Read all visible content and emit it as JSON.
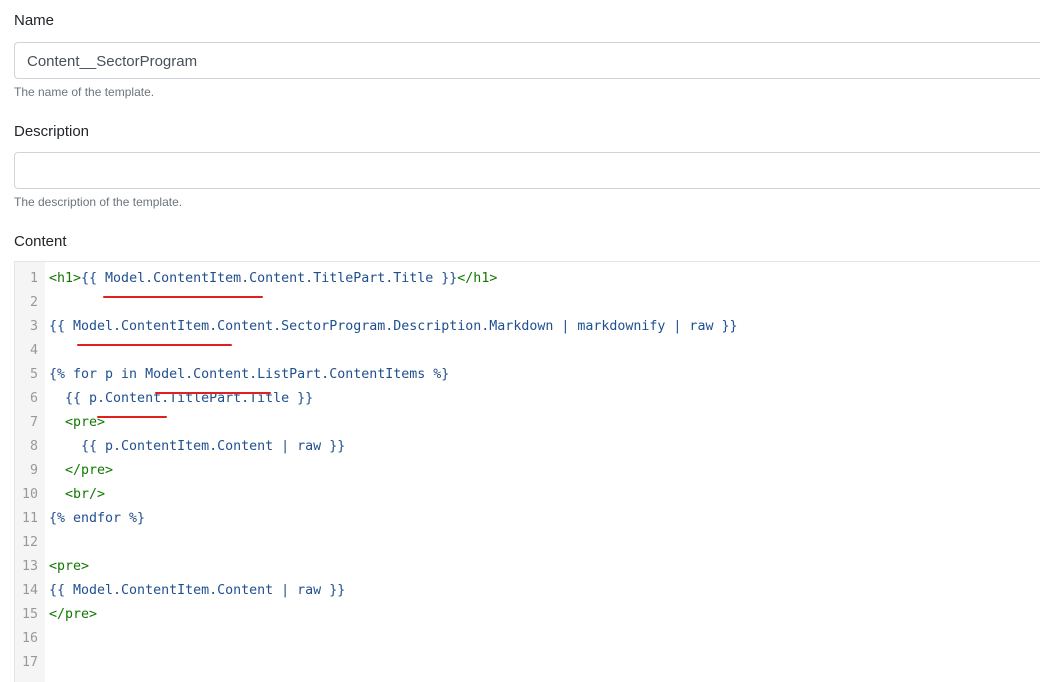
{
  "name_field": {
    "label": "Name",
    "value": "Content__SectorProgram",
    "hint": "The name of the template."
  },
  "description_field": {
    "label": "Description",
    "value": "",
    "hint": "The description of the template."
  },
  "content_field": {
    "label": "Content",
    "lines": [
      {
        "n": "1",
        "tokens": [
          {
            "t": "<h1>",
            "c": "tag"
          },
          {
            "t": "{{ Model.ContentItem.Content.TitlePart.Title }}",
            "c": "liquid"
          },
          {
            "t": "</h1>",
            "c": "tag"
          }
        ]
      },
      {
        "n": "2",
        "tokens": []
      },
      {
        "n": "3",
        "tokens": [
          {
            "t": "{{ Model.ContentItem.Content.SectorProgram.Description.Markdown | markdownify | raw }}",
            "c": "liquid"
          }
        ]
      },
      {
        "n": "4",
        "tokens": []
      },
      {
        "n": "5",
        "tokens": [
          {
            "t": "{% for p in Model.Content.ListPart.ContentItems %}",
            "c": "liquid"
          }
        ]
      },
      {
        "n": "6",
        "tokens": [
          {
            "t": "  {{ p.Content.TitlePart.Title }}",
            "c": "liquid"
          }
        ]
      },
      {
        "n": "7",
        "tokens": [
          {
            "t": "  <pre>",
            "c": "tag"
          }
        ]
      },
      {
        "n": "8",
        "tokens": [
          {
            "t": "    {{ p.ContentItem.Content | raw }}",
            "c": "liquid"
          }
        ]
      },
      {
        "n": "9",
        "tokens": [
          {
            "t": "  </pre>",
            "c": "tag"
          }
        ]
      },
      {
        "n": "10",
        "tokens": [
          {
            "t": "  <br/>",
            "c": "tag"
          }
        ]
      },
      {
        "n": "11",
        "tokens": [
          {
            "t": "{% endfor %}",
            "c": "liquid"
          }
        ]
      },
      {
        "n": "12",
        "tokens": []
      },
      {
        "n": "13",
        "tokens": [
          {
            "t": "<pre>",
            "c": "tag"
          }
        ]
      },
      {
        "n": "14",
        "tokens": [
          {
            "t": "{{ Model.ContentItem.Content | raw }}",
            "c": "liquid"
          }
        ]
      },
      {
        "n": "15",
        "tokens": [
          {
            "t": "</pre>",
            "c": "tag"
          }
        ]
      },
      {
        "n": "16",
        "tokens": []
      },
      {
        "n": "17",
        "tokens": []
      }
    ]
  },
  "colors": {
    "underline": "#e02020",
    "tag": "#117700",
    "liquid": "#1f4f8f",
    "gutter_bg": "#f5f5f5"
  }
}
